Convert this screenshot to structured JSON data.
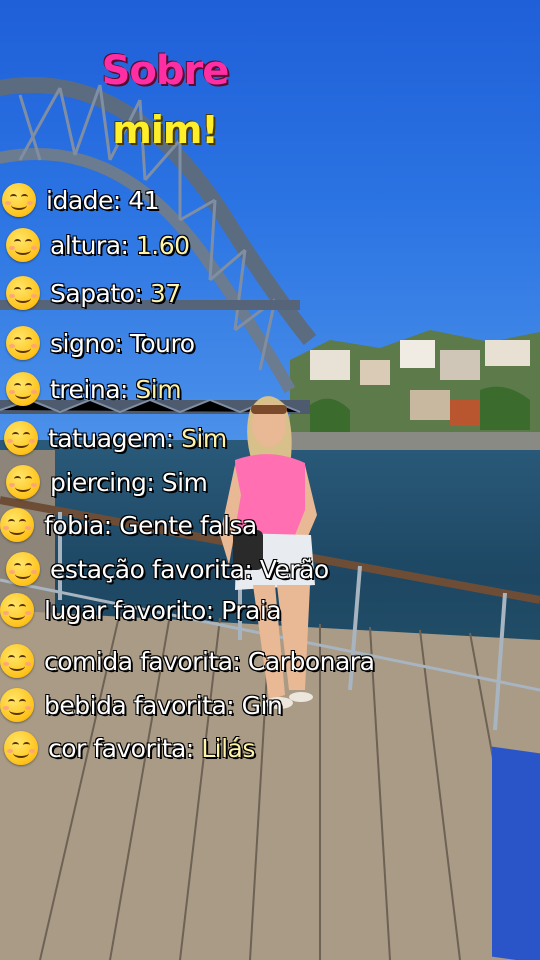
{
  "title": {
    "line1": "Sobre",
    "line2": "mim!"
  },
  "facts": [
    {
      "label": "idade: ",
      "value": "41"
    },
    {
      "label": "altura: ",
      "value": "1.60"
    },
    {
      "label": "Sapato: ",
      "value": "37"
    },
    {
      "label": "signo: ",
      "value": "Touro"
    },
    {
      "label": "treina: ",
      "value": "Sim"
    },
    {
      "label": "tatuagem: ",
      "value": "Sim"
    },
    {
      "label": "piercing: ",
      "value": "Sim"
    },
    {
      "label": "fobia: ",
      "value": "Gente falsa"
    },
    {
      "label": "estação favorita: ",
      "value": "Verão"
    },
    {
      "label": "lugar favorito: ",
      "value": "Praia"
    },
    {
      "label": "comida favorita: ",
      "value": "Carbonara"
    },
    {
      "label": "bebida favorita: ",
      "value": "Gin"
    },
    {
      "label": "cor favorita: ",
      "value": "Lilás"
    }
  ],
  "icons": {
    "row_icon": "smiling-face-emoji-icon"
  },
  "colors": {
    "title_pink": "#ff2fa3",
    "title_yellow": "#ffee2a",
    "value_yellow": "#fff3a8",
    "sky": "#2b74e3"
  }
}
